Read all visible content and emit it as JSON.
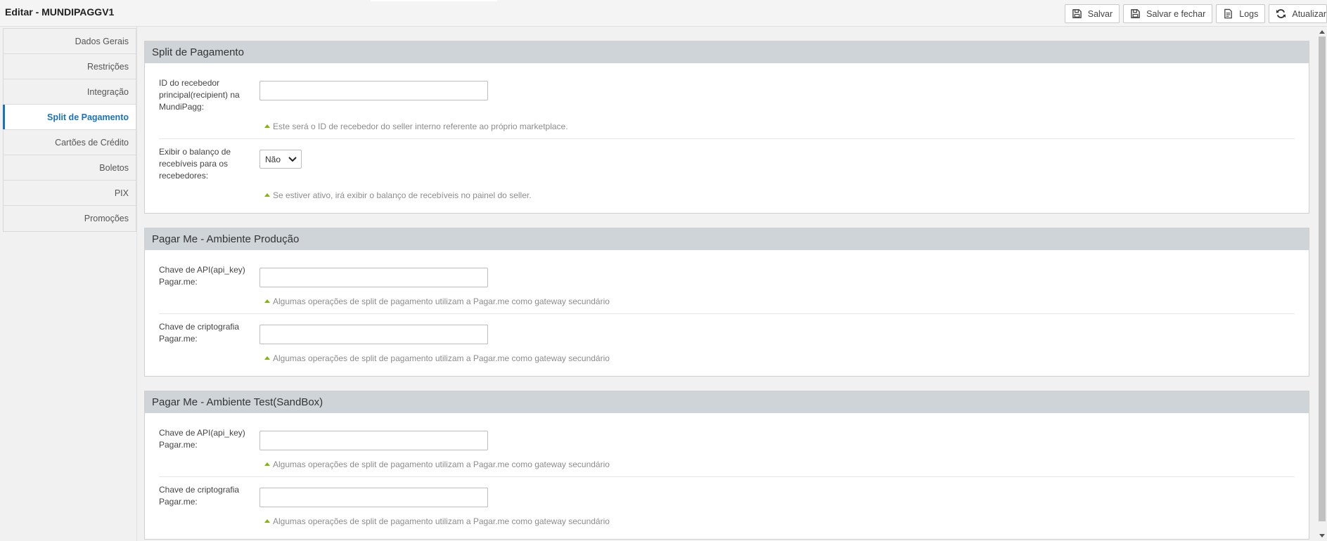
{
  "header": {
    "title": "Editar - MUNDIPAGGV1"
  },
  "toolbar": {
    "save": "Salvar",
    "save_close": "Salvar e fechar",
    "logs": "Logs",
    "refresh": "Atualizar"
  },
  "sidebar": {
    "items": [
      {
        "label": "Dados Gerais"
      },
      {
        "label": "Restrições"
      },
      {
        "label": "Integração"
      },
      {
        "label": "Split de Pagamento"
      },
      {
        "label": "Cartões de Crédito"
      },
      {
        "label": "Boletos"
      },
      {
        "label": "PIX"
      },
      {
        "label": "Promoções"
      }
    ],
    "active": "Split de Pagamento"
  },
  "panels": {
    "split": {
      "title": "Split de Pagamento",
      "recipient_label": "ID do recebedor principal(recipient) na MundiPagg:",
      "recipient_value": "",
      "recipient_hint": "Este será o ID de recebedor do seller interno referente ao próprio marketplace.",
      "balance_label": "Exibir o balanço de recebíveis para os recebedores:",
      "balance_value": "Não",
      "balance_hint": "Se estiver ativo, irá exibir o balanço de recebíveis no painel do seller."
    },
    "prod": {
      "title": "Pagar Me - Ambiente Produção",
      "api_label": "Chave de API(api_key) Pagar.me:",
      "api_value": "",
      "api_hint": "Algumas operações de split de pagamento utilizam a Pagar.me como gateway secundário",
      "crypto_label": "Chave de criptografia Pagar.me:",
      "crypto_value": "",
      "crypto_hint": "Algumas operações de split de pagamento utilizam a Pagar.me como gateway secundário"
    },
    "sandbox": {
      "title": "Pagar Me - Ambiente Test(SandBox)",
      "api_label": "Chave de API(api_key) Pagar.me:",
      "api_value": "",
      "api_hint": "Algumas operações de split de pagamento utilizam a Pagar.me como gateway secundário",
      "crypto_label": "Chave de criptografia Pagar.me:",
      "crypto_value": "",
      "crypto_hint": "Algumas operações de split de pagamento utilizam a Pagar.me como gateway secundário"
    }
  },
  "colors": {
    "accent": "#1a73b8",
    "panel_header": "#cfd4d9",
    "hint_marker": "#7fb800"
  }
}
